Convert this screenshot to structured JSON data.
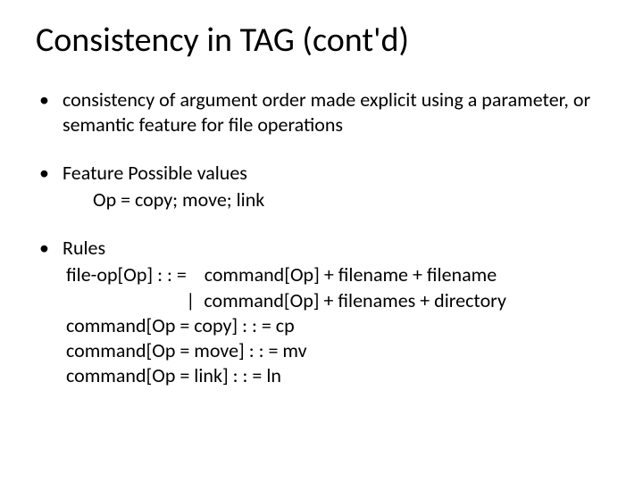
{
  "title": "Consistency in TAG (cont'd)",
  "bullets": {
    "intro": "consistency of argument order made explicit using a parameter, or semantic feature for file operations",
    "feature_label": "Feature Possible values",
    "feature_line": "Op = copy; move; link",
    "rules_label": "Rules",
    "rule1": "file-op[Op] : : =    command[Op] + filename + filename",
    "rule1b": "                           |  command[Op] + filenames + directory",
    "rule2": "command[Op = copy] : : = cp",
    "rule3": "command[Op = move] : : = mv",
    "rule4": "command[Op = link] : : = ln"
  }
}
